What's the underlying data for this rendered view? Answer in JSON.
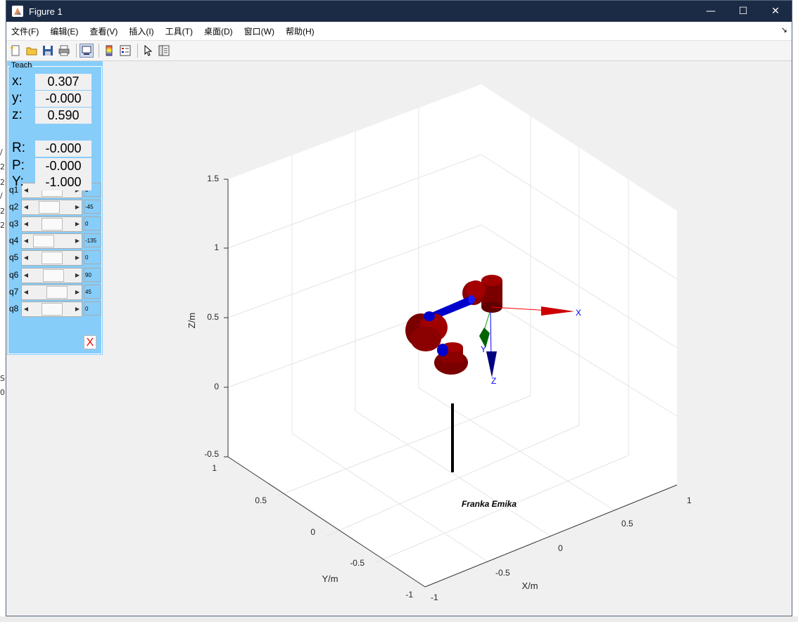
{
  "window": {
    "title": "Figure 1",
    "controls": {
      "minimize": "—",
      "maximize": "☐",
      "close": "✕"
    }
  },
  "menu": {
    "items": [
      "文件(F)",
      "编辑(E)",
      "查看(V)",
      "插入(I)",
      "工具(T)",
      "桌面(D)",
      "窗口(W)",
      "帮助(H)"
    ],
    "dock_arrow": "↘"
  },
  "toolbar": {
    "icons": [
      "new-figure-icon",
      "open-folder-icon",
      "save-icon",
      "print-icon",
      "link-plot-icon",
      "colorbar-icon",
      "legend-icon",
      "pointer-icon",
      "property-inspector-icon"
    ]
  },
  "teach": {
    "label": "Teach",
    "position": [
      {
        "key": "x:",
        "value": "0.307"
      },
      {
        "key": "y:",
        "value": "-0.000"
      },
      {
        "key": "z:",
        "value": "0.590"
      }
    ],
    "orientation": [
      {
        "key": "R:",
        "value": "-0.000"
      },
      {
        "key": "P:",
        "value": "-0.000"
      },
      {
        "key": "Y:",
        "value": "-1.000"
      }
    ],
    "joints": [
      {
        "name": "q1",
        "value": "0",
        "fraction": 0.5
      },
      {
        "name": "q2",
        "value": "-45",
        "fraction": 0.38
      },
      {
        "name": "q3",
        "value": "0",
        "fraction": 0.5
      },
      {
        "name": "q4",
        "value": "-135",
        "fraction": 0.12
      },
      {
        "name": "q5",
        "value": "0",
        "fraction": 0.5
      },
      {
        "name": "q6",
        "value": "90",
        "fraction": 0.58
      },
      {
        "name": "q7",
        "value": "45",
        "fraction": 0.75
      },
      {
        "name": "q8",
        "value": "0",
        "fraction": 0.5
      }
    ],
    "close_label": "X"
  },
  "plot": {
    "zlabel": "Z/m",
    "ylabel": "Y/m",
    "xlabel": "X/m",
    "z_ticks": [
      "1.5",
      "1",
      "0.5",
      "0",
      "-0.5"
    ],
    "y_ticks": [
      "1",
      "0.5",
      "0",
      "-0.5",
      "-1"
    ],
    "x_ticks": [
      "1",
      "0.5",
      "0",
      "-0.5",
      "-1"
    ],
    "robot_name": "Franka Emika",
    "axis_labels": {
      "x": "X",
      "y": "Y",
      "z": "Z"
    },
    "colors": {
      "link": "#8b0000",
      "joint": "#0000cd",
      "x_axis": "#ff0000",
      "y_axis": "#008000",
      "z_axis": "#0000ff"
    }
  },
  "background_fragments": [
    "/",
    "2",
    "2",
    "/",
    "2",
    "2",
    "S",
    "0"
  ]
}
